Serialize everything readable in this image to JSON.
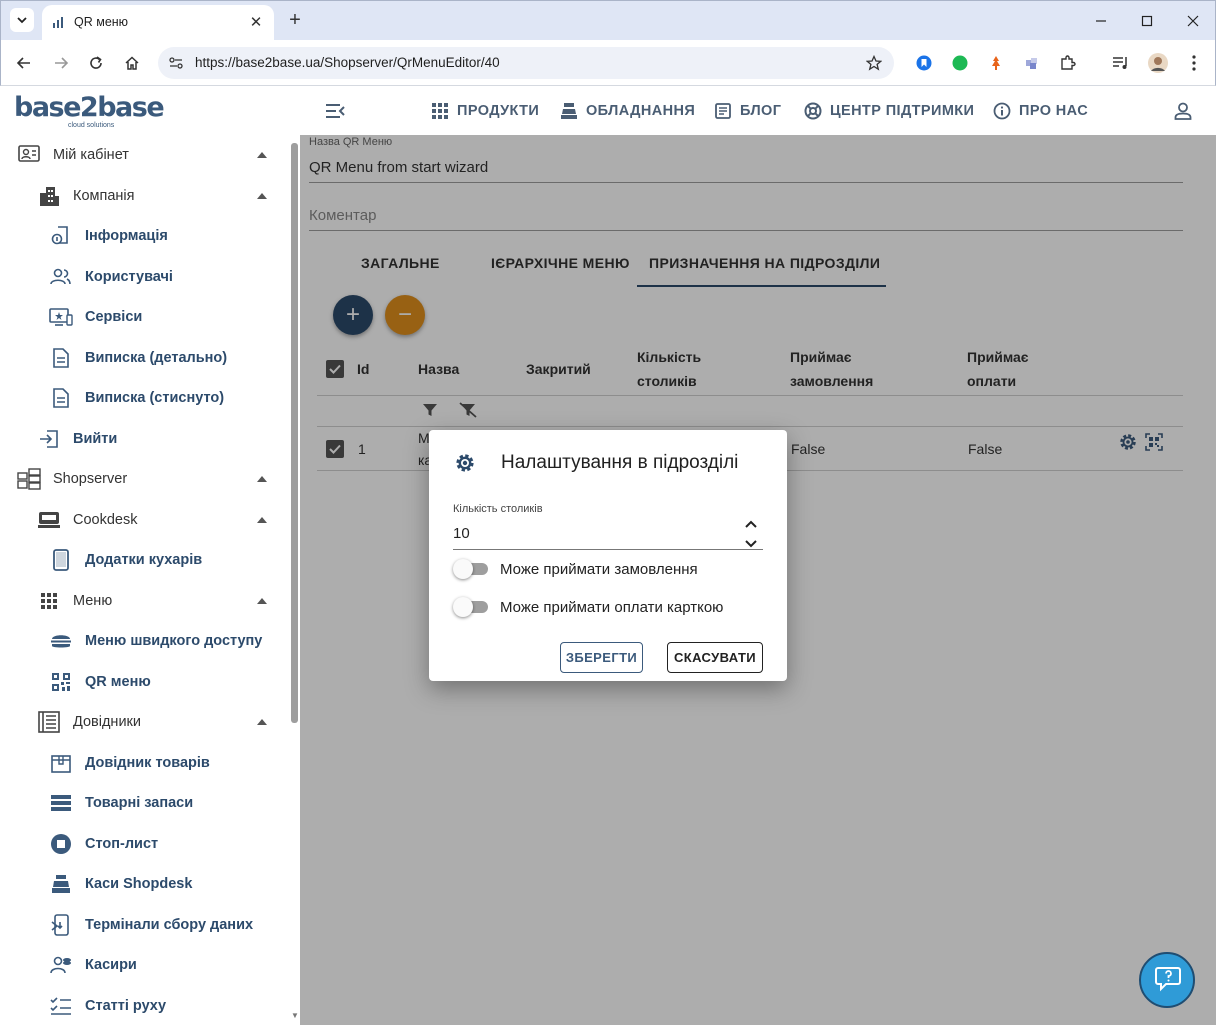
{
  "browser": {
    "tab_title": "QR меню",
    "url": "https://base2base.ua/Shopserver/QrMenuEditor/40"
  },
  "header": {
    "logo_text": "base2base",
    "logo_sub": "cloud solutions",
    "nav": [
      {
        "label": "ПРОДУКТИ",
        "icon": "apps-grid-icon"
      },
      {
        "label": "ОБЛАДНАННЯ",
        "icon": "cash-register-icon"
      },
      {
        "label": "БЛОГ",
        "icon": "article-icon"
      },
      {
        "label": "ЦЕНТР ПІДТРИМКИ",
        "icon": "lifebuoy-icon"
      },
      {
        "label": "ПРО НАС",
        "icon": "info-icon"
      }
    ]
  },
  "sidebar": {
    "items": [
      {
        "label": "Мій кабінет",
        "icon": "account-box-icon",
        "expanded": true
      },
      {
        "label": "Компанія",
        "icon": "buildings-icon",
        "expanded": true
      },
      {
        "label": "Інформація",
        "icon": "info-doc-icon"
      },
      {
        "label": "Користувачі",
        "icon": "users-icon"
      },
      {
        "label": "Сервіси",
        "icon": "services-icon"
      },
      {
        "label": "Виписка (детально)",
        "icon": "document-icon"
      },
      {
        "label": "Виписка (стиснуто)",
        "icon": "document-icon"
      },
      {
        "label": "Вийти",
        "icon": "logout-icon"
      },
      {
        "label": "Shopserver",
        "icon": "server-icon",
        "expanded": true
      },
      {
        "label": "Cookdesk",
        "icon": "cookdesk-icon",
        "expanded": true
      },
      {
        "label": "Додатки кухарів",
        "icon": "tablet-icon"
      },
      {
        "label": "Меню",
        "icon": "grid-icon",
        "expanded": true
      },
      {
        "label": "Меню швидкого доступу",
        "icon": "burger-icon"
      },
      {
        "label": "QR меню",
        "icon": "qr-code-icon"
      },
      {
        "label": "Довідники",
        "icon": "book-icon",
        "expanded": true
      },
      {
        "label": "Довідник товарів",
        "icon": "box-icon"
      },
      {
        "label": "Товарні запаси",
        "icon": "storage-icon"
      },
      {
        "label": "Стоп-лист",
        "icon": "stop-icon"
      },
      {
        "label": "Каси Shopdesk",
        "icon": "register-icon"
      },
      {
        "label": "Термінали сбору даних",
        "icon": "terminal-icon"
      },
      {
        "label": "Касири",
        "icon": "cashier-icon"
      },
      {
        "label": "Статті руху",
        "icon": "checklist-icon"
      }
    ]
  },
  "form": {
    "name_label": "Назва QR Меню",
    "name_value": "QR Menu from start wizard",
    "comment_placeholder": "Коментар"
  },
  "tabs": [
    {
      "label": "ЗАГАЛЬНЕ"
    },
    {
      "label": "ІЄРАРХІЧНЕ МЕНЮ"
    },
    {
      "label": "ПРИЗНАЧЕННЯ НА ПІДРОЗДІЛИ",
      "active": true
    }
  ],
  "table": {
    "headers": {
      "id": "Id",
      "name": "Назва",
      "closed": "Закритий",
      "tables_1": "Кількість",
      "tables_2": "столиків",
      "orders_1": "Приймає",
      "orders_2": "замовлення",
      "payments_1": "Приймає",
      "payments_2": "оплати"
    },
    "rows": [
      {
        "id": "1",
        "name_part1": "М",
        "name_part2": "ка",
        "orders": "False",
        "payments": "False"
      }
    ]
  },
  "dialog": {
    "title": "Налаштування в підрозділі",
    "tables_label": "Кількість столиків",
    "tables_value": "10",
    "toggle_orders": "Може приймати замовлення",
    "toggle_orders_on": false,
    "toggle_payments": "Може приймати оплати карткою",
    "toggle_payments_on": false,
    "save": "ЗБЕРЕГТИ",
    "cancel": "СКАСУВАТИ"
  },
  "colors": {
    "brand": "#3b5a7c",
    "fab_add": "#2c4a6b",
    "fab_remove": "#e0901c",
    "help": "#2f9bd7"
  }
}
